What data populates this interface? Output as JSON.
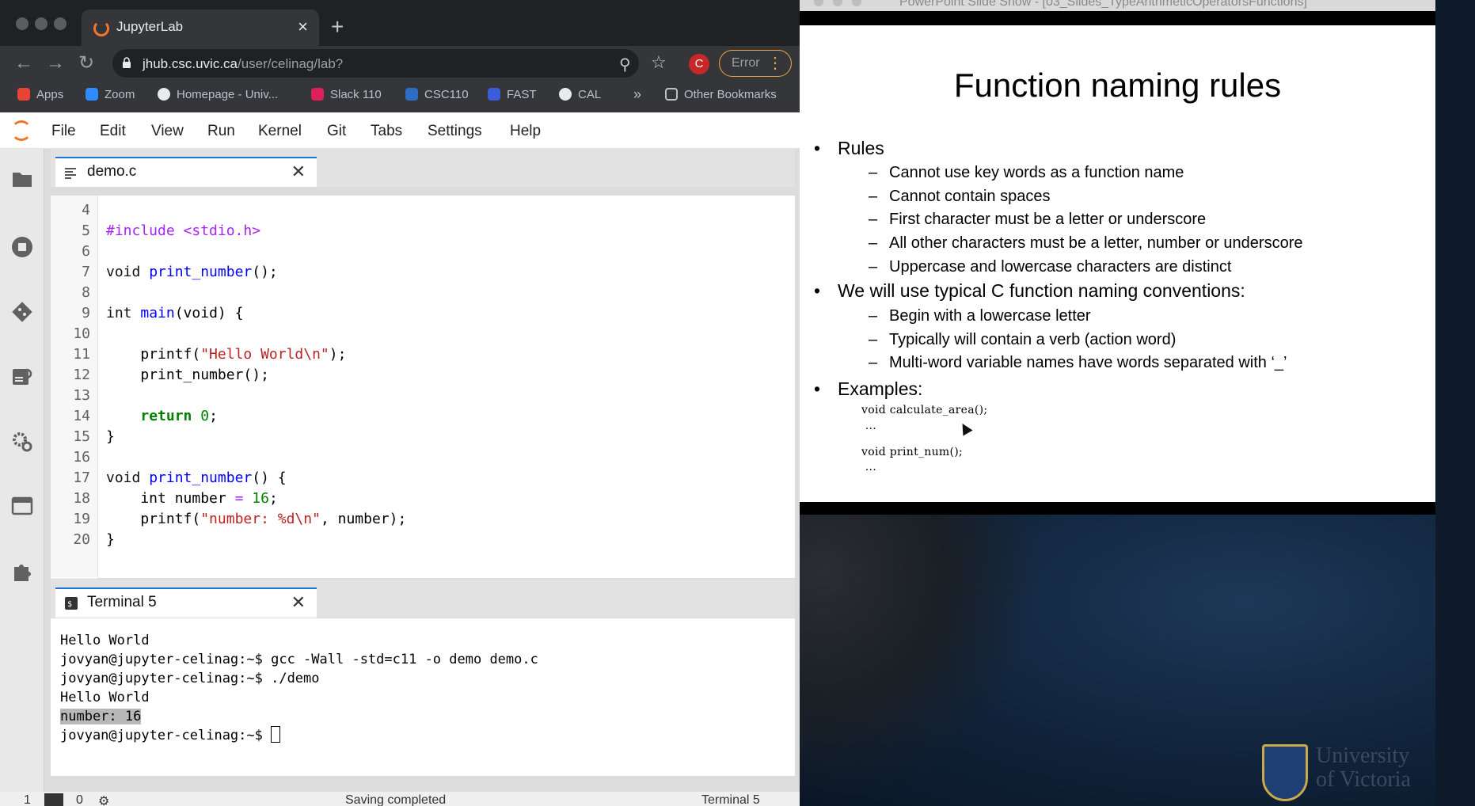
{
  "browser": {
    "tab_title": "JupyterLab",
    "tab_close": "×",
    "new_tab": "+",
    "url_host": "jhub.csc.uvic.ca",
    "url_path": "/user/celinag/lab?",
    "profile_initial": "C",
    "error_label": "Error",
    "bookmarks": [
      {
        "label": "Apps",
        "color": "#ea4335"
      },
      {
        "label": "Zoom",
        "color": "#2d8cff"
      },
      {
        "label": "Homepage - Univ...",
        "color": "#e8eaed"
      },
      {
        "label": "Slack 110",
        "color": "#e01e5a"
      },
      {
        "label": "CSC110",
        "color": "#2d6ec4"
      },
      {
        "label": "FAST",
        "color": "#3b5bdb"
      },
      {
        "label": "CAL",
        "color": "#e8eaed"
      }
    ],
    "bookmarks_overflow": "»",
    "other_bookmarks": "Other Bookmarks"
  },
  "jupyter": {
    "menu": [
      "File",
      "Edit",
      "View",
      "Run",
      "Kernel",
      "Git",
      "Tabs",
      "Settings",
      "Help"
    ],
    "editor_tab": "demo.c",
    "terminal_tab": "Terminal 5",
    "code_lines": [
      {
        "n": "4"
      },
      {
        "n": "5"
      },
      {
        "n": "6"
      },
      {
        "n": "7"
      },
      {
        "n": "8"
      },
      {
        "n": "9"
      },
      {
        "n": "10"
      },
      {
        "n": "11"
      },
      {
        "n": "12"
      },
      {
        "n": "13"
      },
      {
        "n": "14"
      },
      {
        "n": "15"
      },
      {
        "n": "16"
      },
      {
        "n": "17"
      },
      {
        "n": "18"
      },
      {
        "n": "19"
      },
      {
        "n": "20"
      }
    ],
    "code": {
      "l5": "#include <stdio.h>",
      "l7_kw": "void",
      "l7_fn": "print_number",
      "l7_rest": "();",
      "l9_kw": "int",
      "l9_fn": "main",
      "l9_rest": "(void) {",
      "l11_a": "    printf(",
      "l11_s": "\"Hello World\\n\"",
      "l11_b": ");",
      "l12": "    print_number();",
      "l14_kw": "return",
      "l14_n": "0",
      "l14_b": ";",
      "l15": "}",
      "l17_kw": "void",
      "l17_fn": "print_number",
      "l17_rest": "() {",
      "l18_a": "    int number ",
      "l18_op": "=",
      "l18_n": "16",
      "l18_b": ";",
      "l19_a": "    printf(",
      "l19_s": "\"number: %d\\n\"",
      "l19_b": ", number);",
      "l20": "}"
    },
    "terminal_lines": [
      "Hello World",
      "jovyan@jupyter-celinag:~$ gcc -Wall -std=c11 -o demo demo.c",
      "jovyan@jupyter-celinag:~$ ./demo",
      "Hello World"
    ],
    "terminal_selected": "number: 16",
    "terminal_prompt": "jovyan@jupyter-celinag:~$ ",
    "status_left_1": "1",
    "status_left_2": "0",
    "status_center": "Saving completed",
    "status_right": "Terminal 5"
  },
  "slideshow": {
    "window_title": "PowerPoint Slide Show - [03_Slides_TypeArithmeticOperatorsFunctions]",
    "title": "Function naming rules",
    "bullets": {
      "rules": "Rules",
      "rules_items": [
        "Cannot use key words as a function name",
        "Cannot contain spaces",
        "First character must be a letter or underscore",
        "All other characters must be a letter, number or underscore",
        "Uppercase and lowercase characters are distinct"
      ],
      "conventions": "We will use typical C function naming conventions:",
      "conventions_items": [
        "Begin with a lowercase letter",
        "Typically will contain a verb (action word)",
        "Multi-word variable names have words separated with ‘_’"
      ],
      "examples": "Examples:",
      "example_1": "void calculate_area();",
      "example_dots_1": " ...",
      "example_2": "void print_num();",
      "example_dots_2": " ..."
    },
    "logo_text_1": "University",
    "logo_text_2": "of Victoria"
  }
}
